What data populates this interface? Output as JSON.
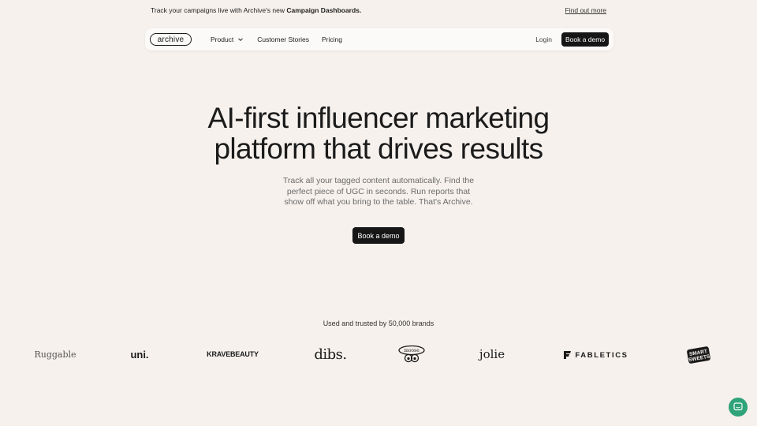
{
  "announcement": {
    "text_prefix": "Track your campaigns live with Archive's new ",
    "text_bold": "Campaign  Dashboards.",
    "link": "Find out more"
  },
  "nav": {
    "logo": "archive",
    "items": [
      "Product",
      "Customer Stories",
      "Pricing"
    ],
    "login": "Login",
    "cta": "Book a demo"
  },
  "hero": {
    "title_line1": "AI-first influencer marketing",
    "title_line2": "platform that drives results",
    "subtitle_line1": "Track all your tagged content automatically. Find the",
    "subtitle_line2": "perfect piece of UGC in seconds. Run reports that",
    "subtitle_line3": "show off what you bring to the table. That's Archive.",
    "cta": "Book a demo"
  },
  "brands": {
    "label": "Used and trusted by 50,000 brands",
    "logos": [
      "Ruggable",
      "uni.",
      "KRAVEBEAUTY",
      "dibs.",
      "moose",
      "jolie",
      "FABLETICS",
      "SMART SWEETS"
    ]
  },
  "colors": {
    "background": "#f6f1ed",
    "button": "#161616",
    "chat": "#2fa37a"
  },
  "icons": {
    "chevron": "chevron-down-icon",
    "chat": "chat-bubble-icon"
  }
}
